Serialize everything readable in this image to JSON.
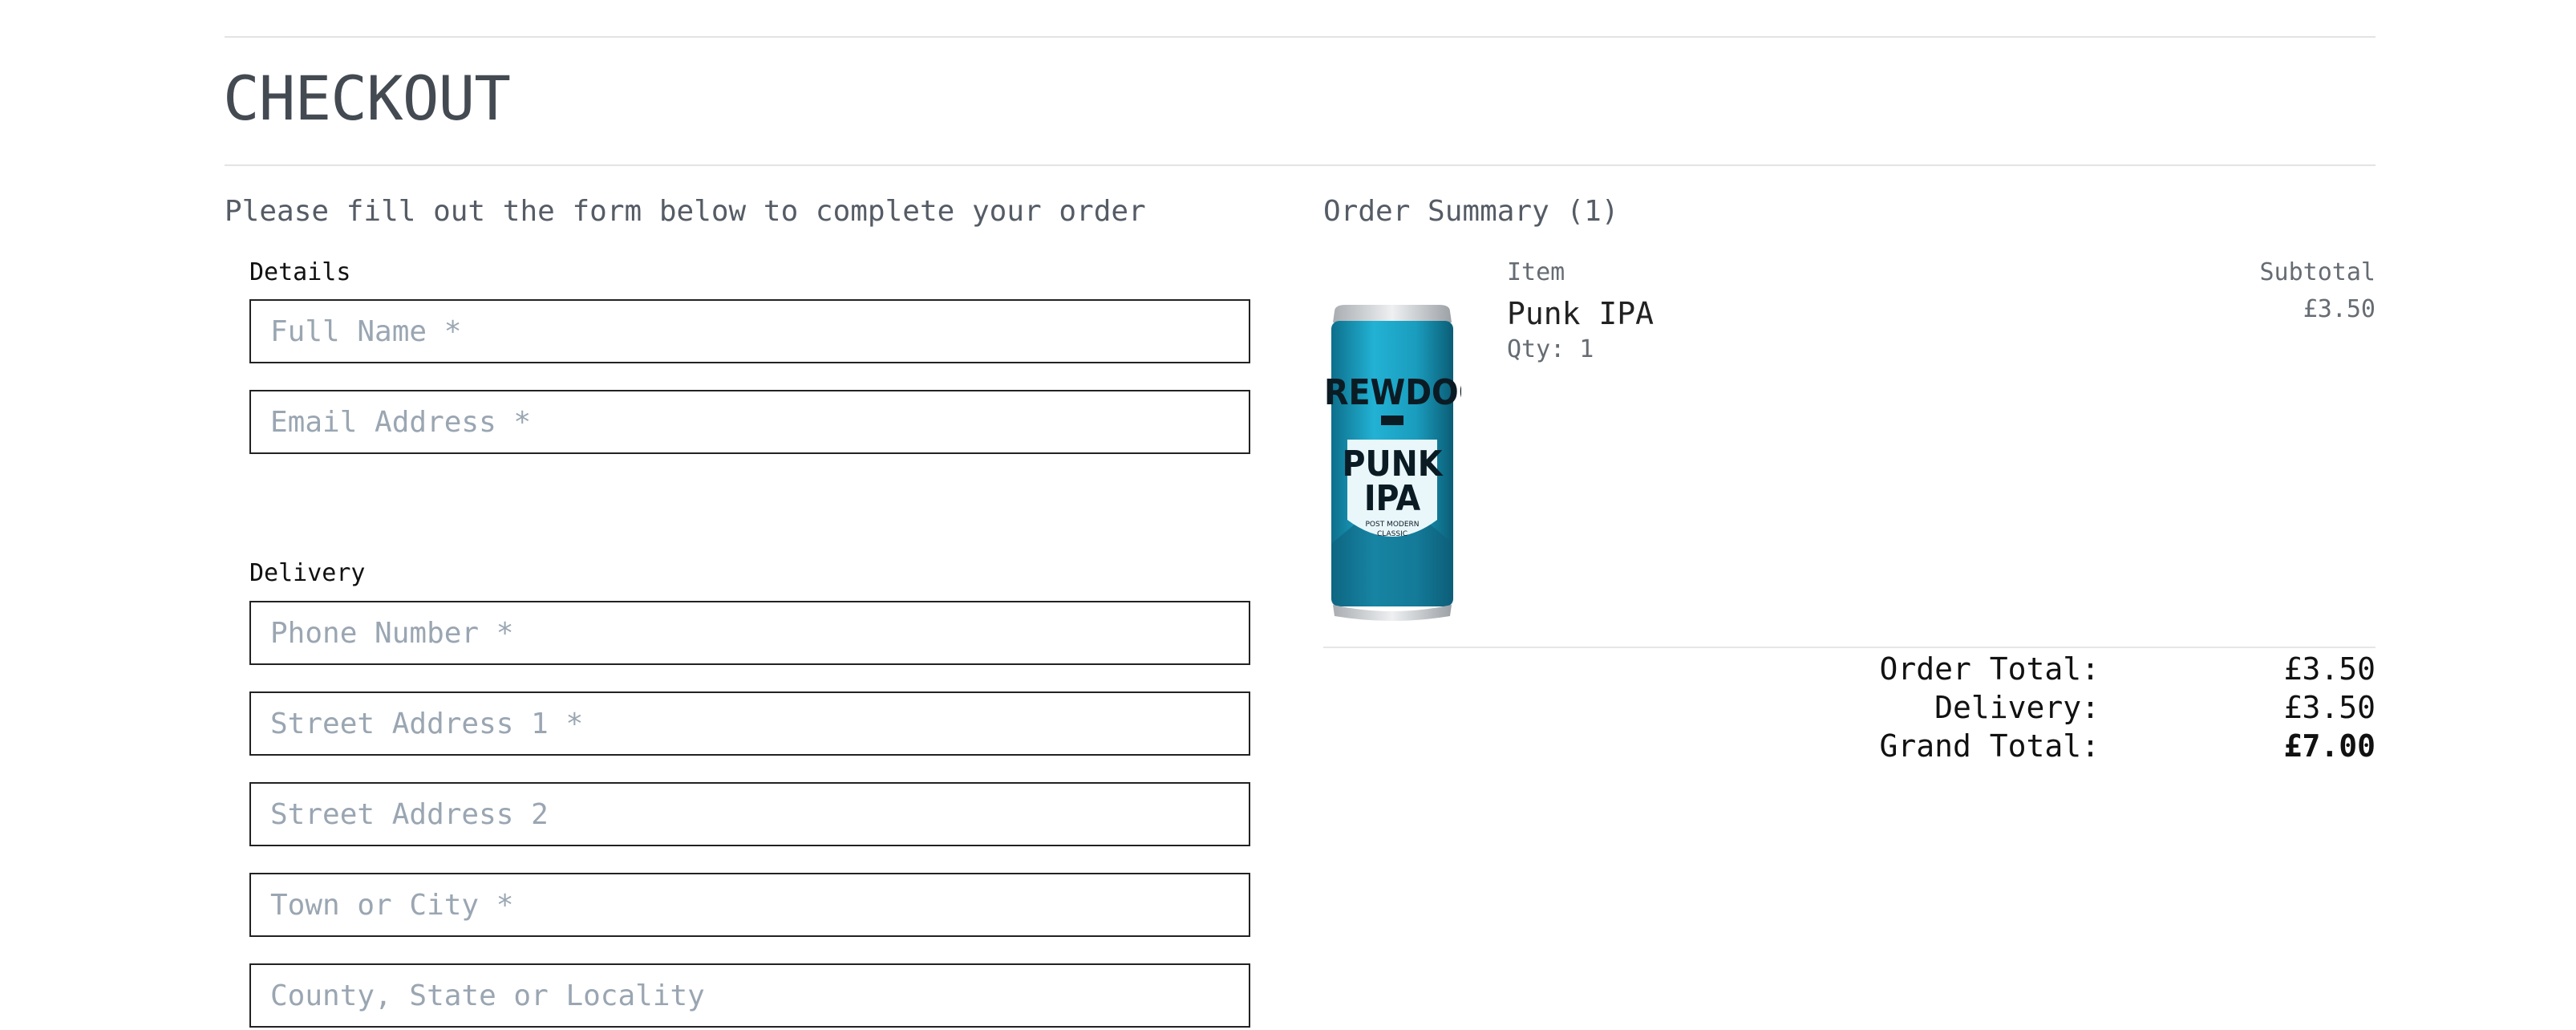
{
  "page": {
    "title": "CHECKOUT"
  },
  "form": {
    "intro": "Please fill out the form below to complete your order",
    "details_label": "Details",
    "delivery_label": "Delivery",
    "fields": {
      "full_name": {
        "placeholder": "Full Name *",
        "value": ""
      },
      "email": {
        "placeholder": "Email Address *",
        "value": ""
      },
      "phone": {
        "placeholder": "Phone Number *",
        "value": ""
      },
      "street1": {
        "placeholder": "Street Address 1 *",
        "value": ""
      },
      "street2": {
        "placeholder": "Street Address 2",
        "value": ""
      },
      "town": {
        "placeholder": "Town or City *",
        "value": ""
      },
      "county": {
        "placeholder": "County, State or Locality",
        "value": ""
      }
    }
  },
  "summary": {
    "title": "Order Summary (1)",
    "col_item": "Item",
    "col_subtotal": "Subtotal",
    "items": [
      {
        "name": "Punk IPA",
        "qty": "Qty: 1",
        "subtotal": "£3.50",
        "image": {
          "brand": "BREWDOG",
          "line1": "PUNK",
          "line2": "IPA",
          "tag1": "POST MODERN",
          "tag2": "CLASSIC",
          "color": "#1fa3c4"
        }
      }
    ],
    "totals": {
      "order_total_label": "Order Total:",
      "order_total": "£3.50",
      "delivery_label": "Delivery:",
      "delivery": "£3.50",
      "grand_total_label": "Grand Total:",
      "grand_total": "£7.00"
    }
  }
}
